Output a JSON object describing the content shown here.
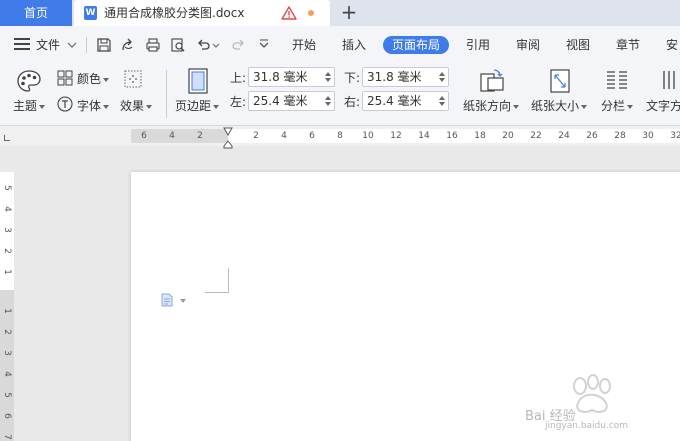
{
  "tabs": {
    "home": "首页",
    "doc_icon": "W",
    "doc_title": "通用合成橡胶分类图.docx",
    "new_tab": "+"
  },
  "menu": {
    "file": "文件",
    "items": [
      "开始",
      "插入",
      "页面布局",
      "引用",
      "审阅",
      "视图",
      "章节",
      "安"
    ],
    "active": "页面布局"
  },
  "ribbon": {
    "theme": "主题",
    "color": "颜色",
    "font": "字体",
    "effect": "效果",
    "margins": "页边距",
    "top_label": "上:",
    "bottom_label": "下:",
    "left_label": "左:",
    "right_label": "右:",
    "top_value": "31.8 毫米",
    "bottom_value": "31.8 毫米",
    "left_value": "25.4 毫米",
    "right_value": "25.4 毫米",
    "orientation": "纸张方向",
    "size": "纸张大小",
    "columns": "分栏",
    "text_direction": "文字方"
  },
  "ruler": {
    "h_left": [
      "6",
      "4",
      "2"
    ],
    "h_right": [
      "2",
      "4",
      "6",
      "8",
      "10",
      "12",
      "14",
      "16",
      "18",
      "20",
      "22",
      "24",
      "26",
      "28",
      "30",
      "32"
    ],
    "v_top": [
      "5",
      "4",
      "3",
      "2",
      "1"
    ],
    "v_bottom": [
      "1",
      "2",
      "3",
      "4",
      "5",
      "6",
      "7"
    ]
  },
  "watermark": {
    "brand": "Bai 经验",
    "url": "jingyan.baidu.com"
  },
  "colors": {
    "accent": "#3f7ce8",
    "tabbar": "#dfe4ec",
    "ribbon": "#f3f5f8"
  }
}
